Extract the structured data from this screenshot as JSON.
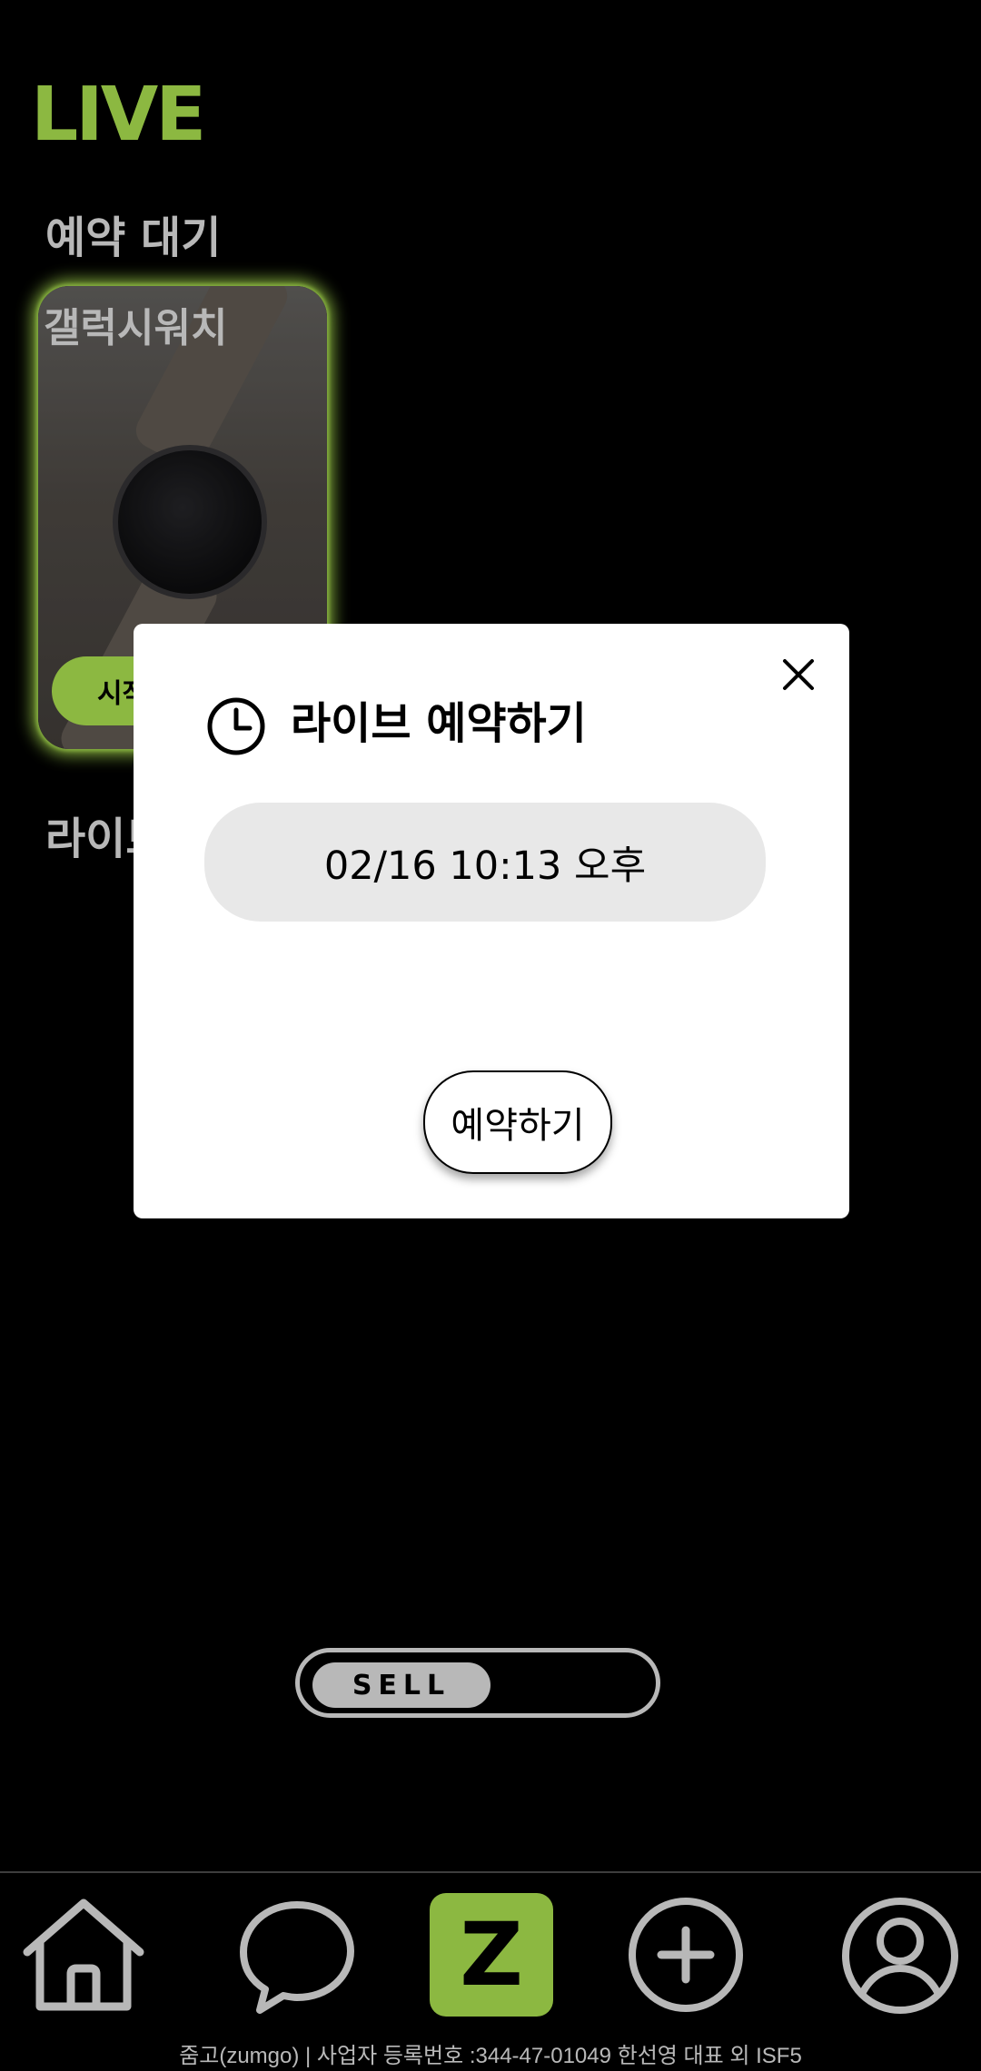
{
  "header": {
    "title": "LIVE"
  },
  "sections": {
    "reserved_title": "예약 대기",
    "live_title": "라이브"
  },
  "card": {
    "title": "갤럭시워치",
    "button_label": "시작"
  },
  "modal": {
    "title": "라이브 예약하기",
    "datetime": "02/16 10:13 오후",
    "submit_label": "예약하기"
  },
  "toggle": {
    "label": "SELL"
  },
  "nav": {
    "items": [
      {
        "icon": "home-icon"
      },
      {
        "icon": "chat-icon"
      },
      {
        "icon": "zumgo-logo",
        "label": "Z"
      },
      {
        "icon": "add-icon"
      },
      {
        "icon": "profile-icon"
      }
    ]
  },
  "footer": {
    "text": "줌고(zumgo) | 사업자 등록번호 :344-47-01049 한선영 대표 외 ISF5"
  },
  "colors": {
    "accent": "#c2ff5a",
    "background": "#000000",
    "modal_bg": "#ffffff",
    "field_bg": "#e8e8e8"
  }
}
